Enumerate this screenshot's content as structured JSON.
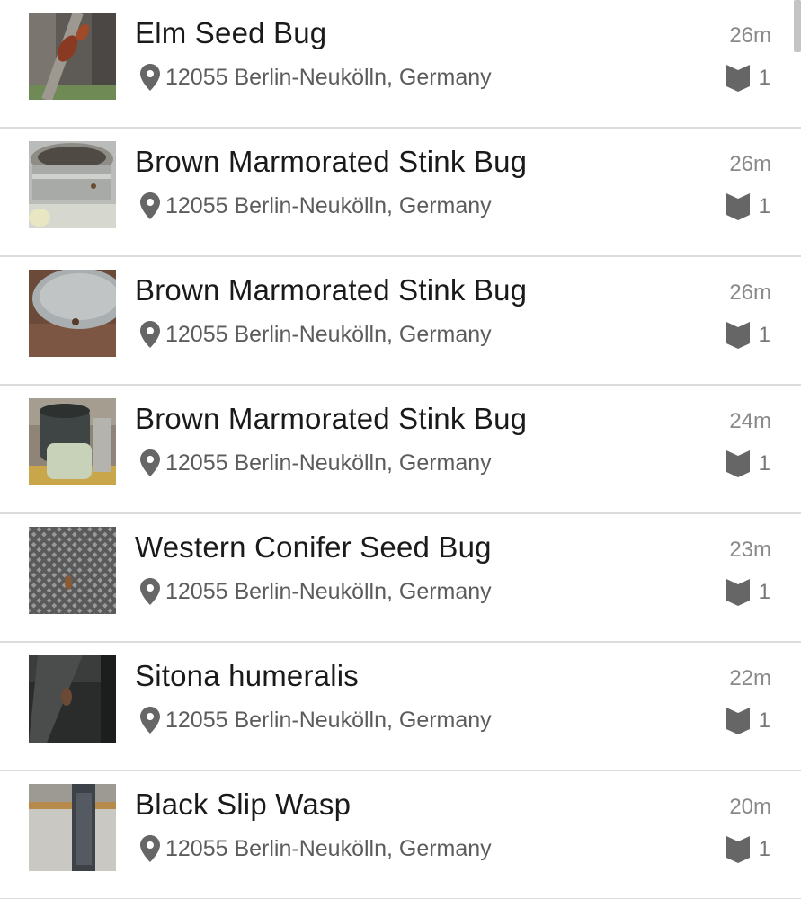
{
  "observations": [
    {
      "name": "Elm Seed Bug",
      "location": "12055 Berlin-Neukölln, Germany",
      "time": "26m",
      "count": "1"
    },
    {
      "name": "Brown Marmorated Stink Bug",
      "location": "12055 Berlin-Neukölln, Germany",
      "time": "26m",
      "count": "1"
    },
    {
      "name": "Brown Marmorated Stink Bug",
      "location": "12055 Berlin-Neukölln, Germany",
      "time": "26m",
      "count": "1"
    },
    {
      "name": "Brown Marmorated Stink Bug",
      "location": "12055 Berlin-Neukölln, Germany",
      "time": "24m",
      "count": "1"
    },
    {
      "name": "Western Conifer Seed Bug",
      "location": "12055 Berlin-Neukölln, Germany",
      "time": "23m",
      "count": "1"
    },
    {
      "name": "Sitona humeralis",
      "location": "12055 Berlin-Neukölln, Germany",
      "time": "22m",
      "count": "1"
    },
    {
      "name": "Black Slip Wasp",
      "location": "12055 Berlin-Neukölln, Germany",
      "time": "20m",
      "count": "1"
    }
  ],
  "icons": {
    "location": "location-pin-icon",
    "identifications": "identification-badge-icon"
  },
  "colors": {
    "title": "#1a1a1a",
    "location": "#5c5c5c",
    "time": "#8a8a8a",
    "icon": "#666666",
    "divider": "#dcdcdc"
  }
}
